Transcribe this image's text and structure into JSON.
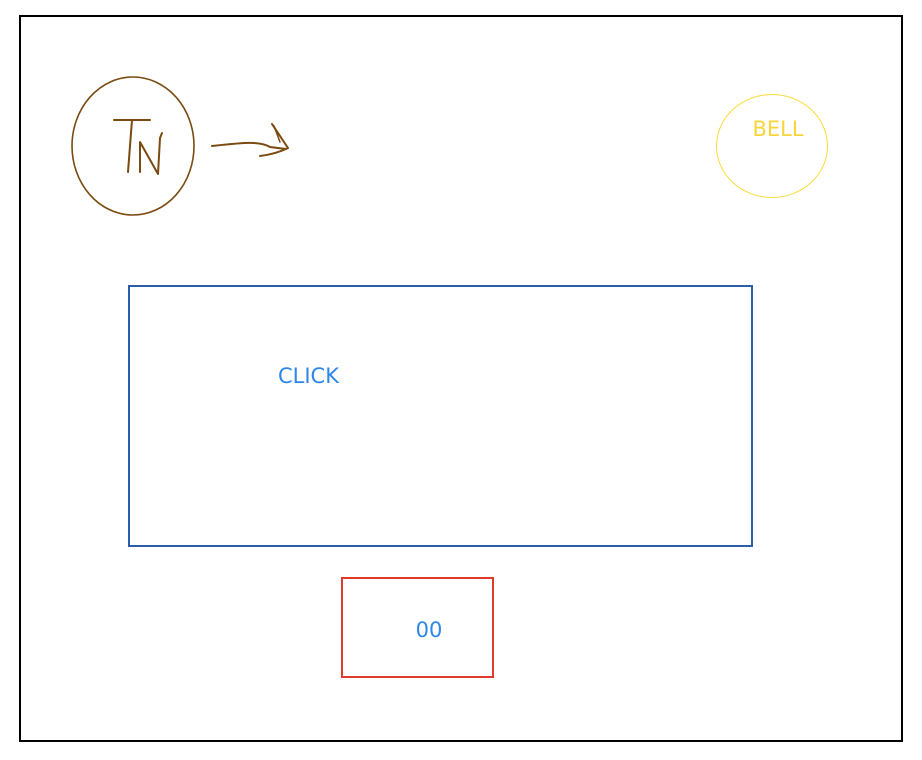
{
  "logo": {
    "icon": "tn-monogram-icon",
    "text": "TN",
    "color": "#7a4a10"
  },
  "arrow": {
    "icon": "arrow-right-icon",
    "color": "#7a4a10"
  },
  "bell": {
    "label": "BELL",
    "color": "#f7d53a"
  },
  "click_area": {
    "label": "CLICK",
    "border_color": "#2b5ea8",
    "text_color": "#2e86e8"
  },
  "counter": {
    "value": "00",
    "border_color": "#e03a2c",
    "text_color": "#2e86e8"
  }
}
